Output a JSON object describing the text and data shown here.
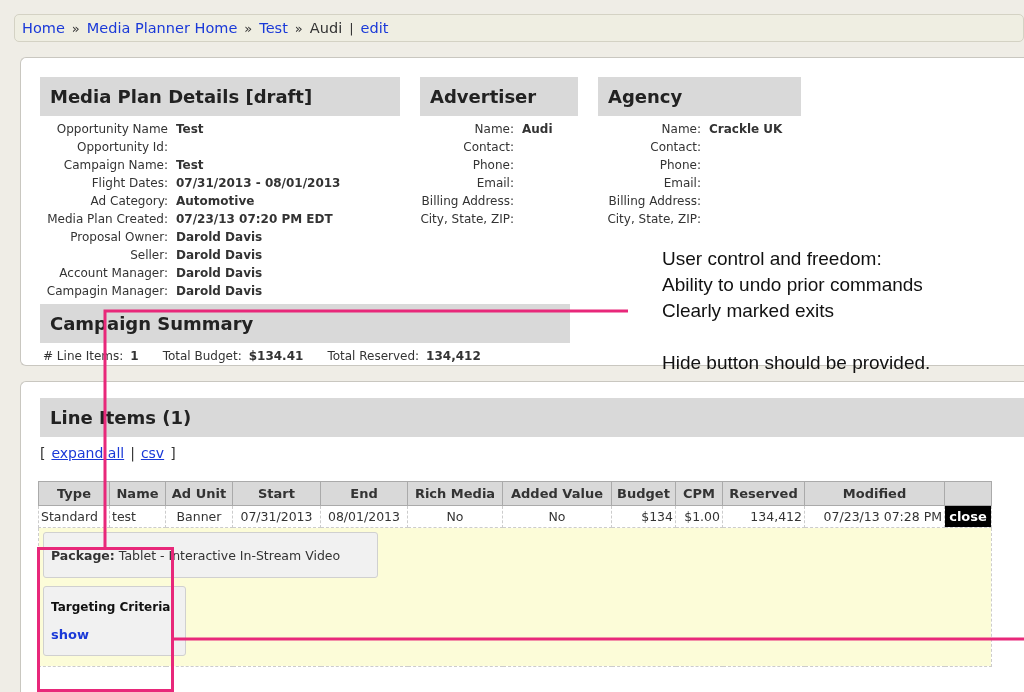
{
  "breadcrumb": [
    {
      "text": "Home",
      "kind": "link"
    },
    {
      "text": "»",
      "kind": "separator"
    },
    {
      "text": "Media Planner Home",
      "kind": "link"
    },
    {
      "text": "»",
      "kind": "separator"
    },
    {
      "text": "Test",
      "kind": "link"
    },
    {
      "text": "»",
      "kind": "separator"
    },
    {
      "text": "Audi",
      "kind": "plain"
    },
    {
      "text": "|",
      "kind": "separator"
    },
    {
      "text": "edit",
      "kind": "link"
    }
  ],
  "details": {
    "title": "Media Plan Details [draft]",
    "fields": [
      {
        "label": "Opportunity Name",
        "value": "Test"
      },
      {
        "label": "Opportunity Id:"
      },
      {
        "label": "Campaign Name:",
        "value": "Test"
      },
      {
        "label": "Flight Dates:",
        "value": "07/31/2013 - 08/01/2013"
      },
      {
        "label": "Ad Category:",
        "value": "Automotive"
      },
      {
        "label": "Media Plan Created:",
        "value": "07/23/13 07:20 PM EDT"
      },
      {
        "label": "Proposal Owner:",
        "value": "Darold Davis"
      },
      {
        "label": "Seller:",
        "value": "Darold Davis"
      },
      {
        "label": "Account Manager:",
        "value": "Darold Davis"
      },
      {
        "label": "Campagin Manager:",
        "value": "Darold Davis"
      }
    ]
  },
  "advertiser": {
    "title": "Advertiser",
    "fields": [
      {
        "label": "Name:",
        "value": "Audi"
      },
      {
        "label": "Contact:"
      },
      {
        "label": "Phone:"
      },
      {
        "label": "Email:"
      },
      {
        "label": "Billing Address:"
      },
      {
        "label": "City, State, ZIP:"
      }
    ]
  },
  "agency": {
    "title": "Agency",
    "fields": [
      {
        "label": "Name:",
        "value": "Crackle UK"
      },
      {
        "label": "Contact:"
      },
      {
        "label": "Phone:"
      },
      {
        "label": "Email:"
      },
      {
        "label": "Billing Address:"
      },
      {
        "label": "City, State, ZIP:"
      }
    ]
  },
  "campaign_summary": {
    "title": "Campaign Summary",
    "items": [
      {
        "label": "# Line Items:",
        "value": "1"
      },
      {
        "label": "Total Budget:",
        "value": "$134.41"
      },
      {
        "label": "Total Reserved:",
        "value": "134,412"
      }
    ]
  },
  "annotation": {
    "paragraphs": [
      [
        "User control and freedom:",
        "Ability to undo prior commands",
        "Clearly marked exits"
      ],
      [
        "Hide button should be provided."
      ]
    ]
  },
  "line_items": {
    "title": "Line Items (1)",
    "links": [
      {
        "text": "[",
        "kind": "bracket"
      },
      {
        "text": "expand all",
        "kind": "link"
      },
      {
        "text": "|",
        "kind": "separator"
      },
      {
        "text": "csv",
        "kind": "link"
      },
      {
        "text": "]",
        "kind": "bracket"
      }
    ],
    "table": {
      "columns": [
        "Type",
        "Name",
        "Ad Unit",
        "Start",
        "End",
        "Rich Media",
        "Added Value",
        "Budget",
        "CPM",
        "Reserved",
        "Modified"
      ],
      "rows": [
        {
          "cells": [
            "Standard",
            "test",
            "Banner",
            "07/31/2013",
            "08/01/2013",
            "No",
            "No",
            "$134",
            "$1.00",
            "134,412",
            "07/23/13 07:28 PM"
          ],
          "action": "close",
          "expanded": true,
          "package": {
            "label": "Package:",
            "value": "Tablet - Interactive In-Stream Video"
          },
          "targeting": {
            "title": "Targeting Criteria",
            "link": "show"
          }
        }
      ]
    }
  }
}
